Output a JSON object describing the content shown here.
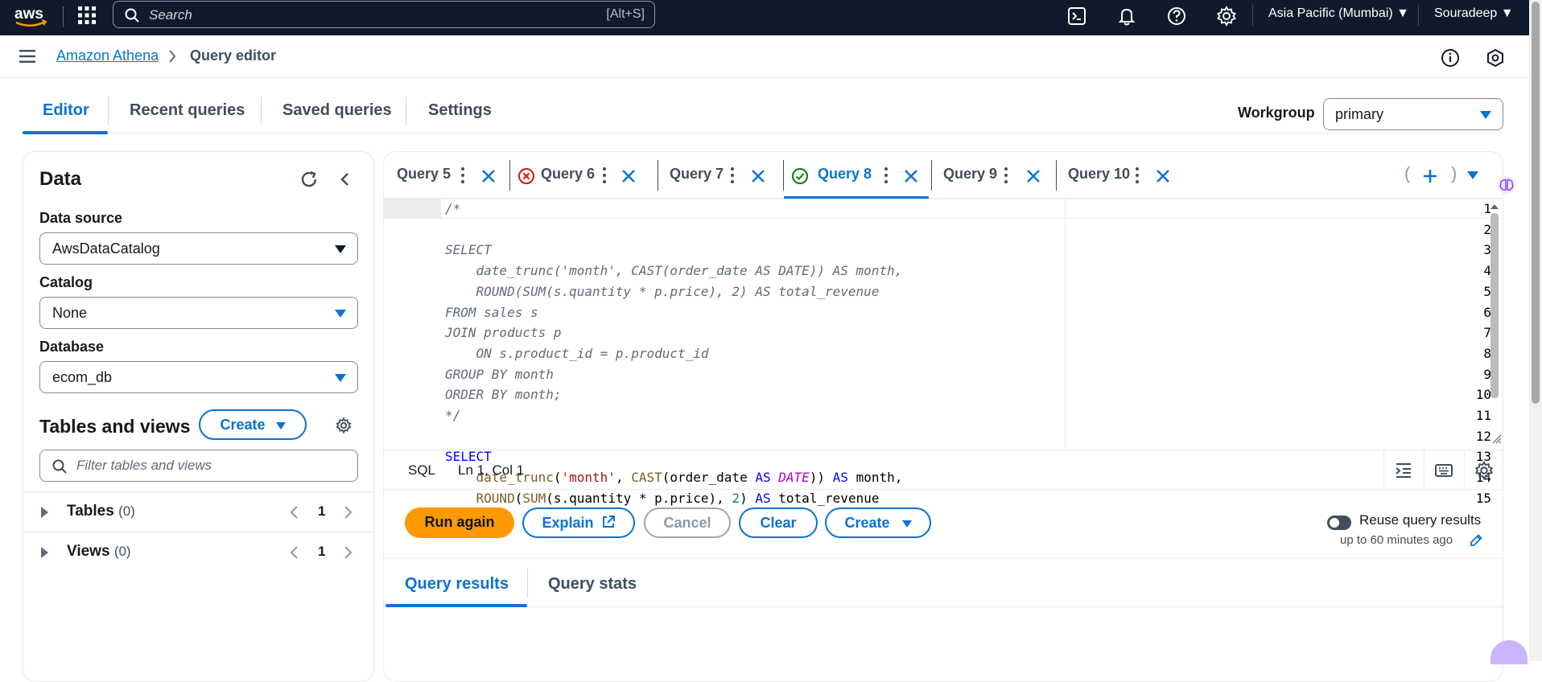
{
  "topbar": {
    "logo_text": "aws",
    "search_placeholder": "Search",
    "search_shortcut": "[Alt+S]",
    "region": "Asia Pacific (Mumbai)",
    "user": "Souradeep"
  },
  "breadcrumb": {
    "service": "Amazon Athena",
    "page": "Query editor"
  },
  "main_tabs": [
    "Editor",
    "Recent queries",
    "Saved queries",
    "Settings"
  ],
  "workgroup": {
    "label": "Workgroup",
    "value": "primary"
  },
  "data_panel": {
    "title": "Data",
    "data_source_label": "Data source",
    "data_source_value": "AwsDataCatalog",
    "catalog_label": "Catalog",
    "catalog_value": "None",
    "database_label": "Database",
    "database_value": "ecom_db",
    "tables_views_title": "Tables and views",
    "create_label": "Create",
    "filter_placeholder": "Filter tables and views",
    "tables_label": "Tables",
    "tables_count": "(0)",
    "tables_page": "1",
    "views_label": "Views",
    "views_count": "(0)",
    "views_page": "1"
  },
  "query_tabs": [
    {
      "name": "Query 5",
      "status": "none"
    },
    {
      "name": "Query 6",
      "status": "error"
    },
    {
      "name": "Query 7",
      "status": "none"
    },
    {
      "name": "Query 8",
      "status": "success",
      "active": true
    },
    {
      "name": "Query 9",
      "status": "none"
    },
    {
      "name": "Query 10",
      "status": "none"
    }
  ],
  "editor": {
    "line_numbers": [
      "1",
      "2",
      "3",
      "4",
      "5",
      "6",
      "7",
      "8",
      "9",
      "10",
      "11",
      "12",
      "13",
      "14",
      "15"
    ],
    "lines": [
      "/*",
      "",
      "SELECT",
      "    date_trunc('month', CAST(order_date AS DATE)) AS month,",
      "    ROUND(SUM(s.quantity * p.price), 2) AS total_revenue",
      "FROM sales s",
      "JOIN products p",
      "    ON s.product_id = p.product_id",
      "GROUP BY month",
      "ORDER BY month;",
      "*/",
      "",
      "SELECT",
      "    date_trunc('month', CAST(order_date AS DATE)) AS month,",
      "    ROUND(SUM(s.quantity * p.price), 2) AS total_revenue"
    ],
    "language": "SQL",
    "cursor_position": "Ln 1, Col 1"
  },
  "actions": {
    "run": "Run again",
    "explain": "Explain",
    "cancel": "Cancel",
    "clear": "Clear",
    "create": "Create",
    "reuse_label": "Reuse query results",
    "reuse_detail": "up to 60 minutes ago",
    "reuse_enabled": false
  },
  "result_tabs": [
    "Query results",
    "Query stats"
  ],
  "colors": {
    "accent": "#0972d3",
    "run_button": "#ff9900",
    "topbar": "#0f1b2a",
    "error": "#d91515",
    "success": "#037f0c"
  }
}
